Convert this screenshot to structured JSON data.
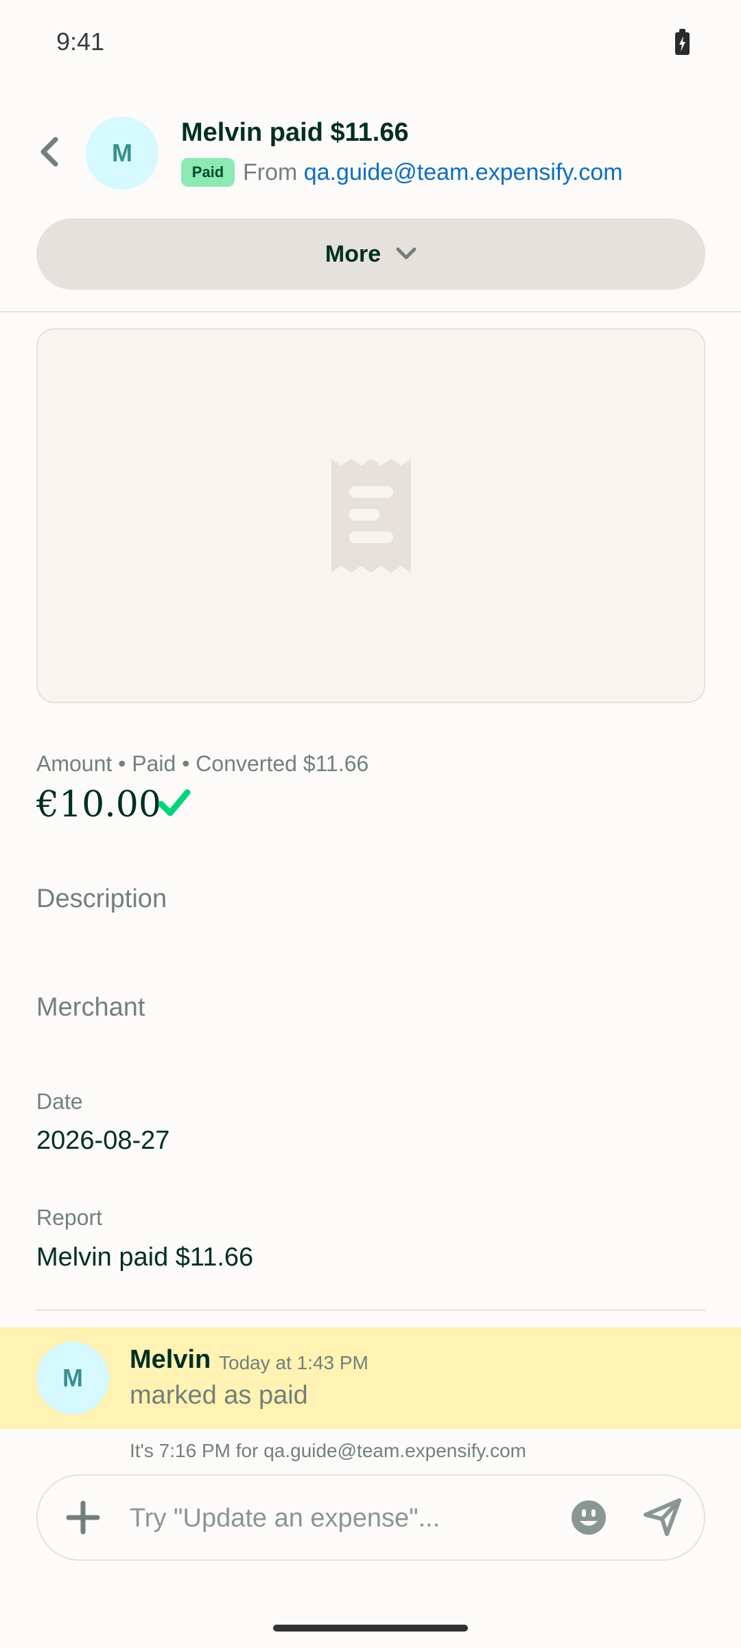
{
  "status_bar": {
    "time": "9:41",
    "battery_icon": "battery-charging-icon"
  },
  "header": {
    "back_icon": "chevron-left-icon",
    "avatar_initial": "M",
    "title": "Melvin paid $11.66",
    "badge": "Paid",
    "from_prefix": "From",
    "from_email": "qa.guide@team.expensify.com"
  },
  "more_button": {
    "label": "More",
    "icon": "chevron-down-icon"
  },
  "receipt": {
    "icon": "receipt-icon"
  },
  "amount": {
    "label": "Amount • Paid • Converted $11.66",
    "value": "€10.00",
    "icon": "checkmark-icon"
  },
  "fields": {
    "description_label": "Description",
    "merchant_label": "Merchant",
    "date_label": "Date",
    "date_value": "2026-08-27",
    "report_label": "Report",
    "report_value": "Melvin paid $11.66"
  },
  "activity": {
    "avatar_initial": "M",
    "name": "Melvin",
    "time": "Today at 1:43 PM",
    "message": "marked as paid"
  },
  "local_time_note": "It's 7:16 PM for qa.guide@team.expensify.com",
  "composer": {
    "placeholder": "Try \"Update an expense\"...",
    "value": ""
  },
  "colors": {
    "background": "#fcfbf9",
    "text_primary": "#002e22",
    "text_muted": "#72807b",
    "link": "#0e6ec2",
    "badge_green": "#8ce8b4",
    "success_check": "#03d47c",
    "avatar_bg": "#d6f8ff",
    "highlight_yellow": "#fff2b2"
  }
}
